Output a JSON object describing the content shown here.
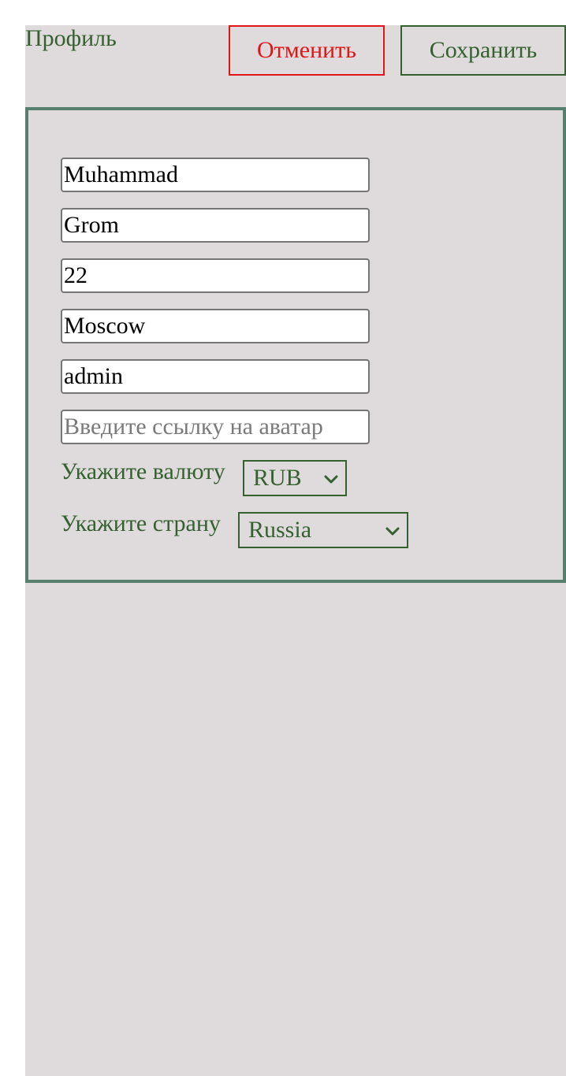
{
  "header": {
    "title": "Профиль",
    "cancel_label": "Отменить",
    "save_label": "Сохранить"
  },
  "form": {
    "first_name": "Muhammad",
    "last_name": "Grom",
    "age": "22",
    "city": "Moscow",
    "username": "admin",
    "avatar_value": "",
    "avatar_placeholder": "Введите ссылку на аватар",
    "currency_label": "Укажите валюту",
    "currency_value": "RUB",
    "country_label": "Укажите страну",
    "country_value": "Russia"
  },
  "colors": {
    "accent_green": "#356131",
    "cancel_red": "#e01616",
    "card_border": "#567f70",
    "background": "#dfdadb"
  },
  "icons": {
    "dropdown": "chevron-down-icon"
  }
}
